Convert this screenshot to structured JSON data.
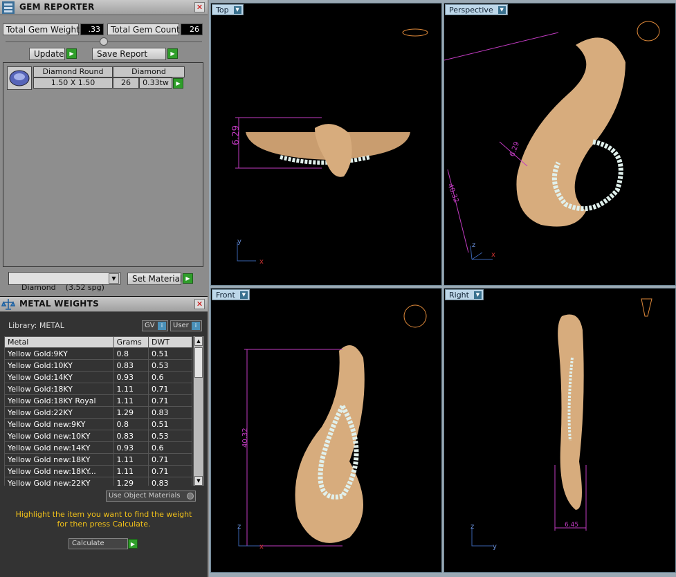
{
  "gem_reporter": {
    "title": "GEM REPORTER",
    "total_weight_label": "Total Gem Weight",
    "total_weight_value": ".33",
    "total_count_label": "Total Gem Count",
    "total_count_value": "26",
    "update_label": "Update",
    "save_report_label": "Save Report",
    "gem_row": {
      "name": "Diamond Round",
      "material": "Diamond",
      "size": "1.50 X 1.50",
      "count": "26",
      "weight": "0.33tw"
    },
    "material_select": "Diamond    (3.52 spg)",
    "set_material_label": "Set Material"
  },
  "metal_weights": {
    "title": "METAL WEIGHTS",
    "library_label": "Library: METAL",
    "gv_label": "GV",
    "user_label": "User",
    "columns": [
      "Metal",
      "Grams",
      "DWT"
    ],
    "rows": [
      [
        "Yellow Gold:9KY",
        "0.8",
        "0.51"
      ],
      [
        "Yellow Gold:10KY",
        "0.83",
        "0.53"
      ],
      [
        "Yellow Gold:14KY",
        "0.93",
        "0.6"
      ],
      [
        "Yellow Gold:18KY",
        "1.11",
        "0.71"
      ],
      [
        "Yellow Gold:18KY Royal",
        "1.11",
        "0.71"
      ],
      [
        "Yellow Gold:22KY",
        "1.29",
        "0.83"
      ],
      [
        "Yellow Gold new:9KY",
        "0.8",
        "0.51"
      ],
      [
        "Yellow Gold new:10KY",
        "0.83",
        "0.53"
      ],
      [
        "Yellow Gold new:14KY",
        "0.93",
        "0.6"
      ],
      [
        "Yellow Gold new:18KY",
        "1.11",
        "0.71"
      ],
      [
        "Yellow Gold new:18KY...",
        "1.11",
        "0.71"
      ],
      [
        "Yellow Gold new:22KY",
        "1.29",
        "0.83"
      ]
    ],
    "use_object_materials_label": "Use Object Materials",
    "hint": "Highlight the item you want to find the weight for then press Calculate.",
    "calculate_label": "Calculate"
  },
  "viewports": [
    {
      "label": "Top",
      "dimension": "6.29"
    },
    {
      "label": "Perspective",
      "dimension": "6.29",
      "dimension2": "40.32"
    },
    {
      "label": "Front",
      "dimension": "40.32"
    },
    {
      "label": "Right",
      "dimension": "6.45"
    }
  ],
  "axes": {
    "x": "x",
    "y": "y",
    "z": "z"
  },
  "colors": {
    "gold": "#d7ac7d",
    "gem": "#e0f0ec",
    "dim": "#c23bc2",
    "hint": "#f2c21a"
  }
}
